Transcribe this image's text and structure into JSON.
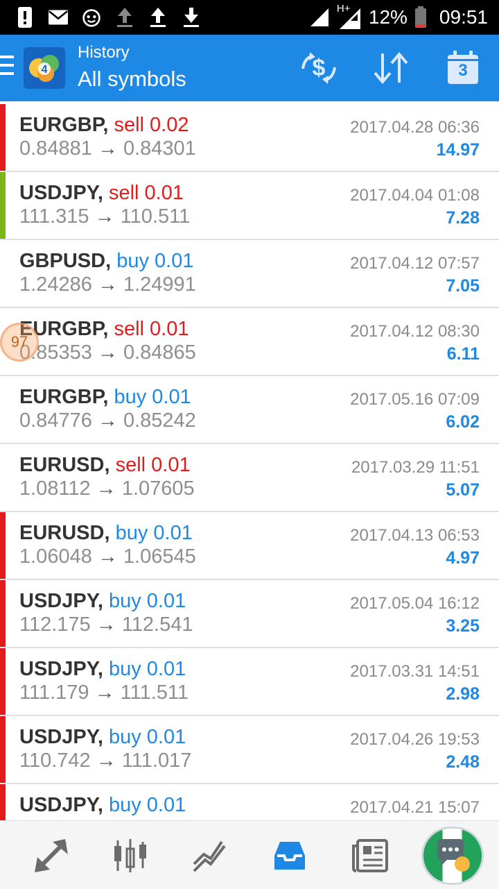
{
  "statusbar": {
    "network": "H+",
    "battery": "12%",
    "time": "09:51"
  },
  "appbar": {
    "subtitle": "History",
    "title": "All symbols",
    "calendar_day": "3"
  },
  "colors": {
    "accent": "#1e88e5",
    "sell": "#e21c1c",
    "buy": "#1e88e5",
    "bar_red": "#e21c1c",
    "bar_green": "#7cb518"
  },
  "trades": [
    {
      "symbol": "EURGBP,",
      "side": "sell",
      "volume": "sell 0.02",
      "open": "0.84881",
      "close": "0.84301",
      "date": "2017.04.28 06:36",
      "profit": "14.97",
      "bar": "red"
    },
    {
      "symbol": "USDJPY,",
      "side": "sell",
      "volume": "sell 0.01",
      "open": "111.315",
      "close": "110.511",
      "date": "2017.04.04 01:08",
      "profit": "7.28",
      "bar": "green"
    },
    {
      "symbol": "GBPUSD,",
      "side": "buy",
      "volume": "buy 0.01",
      "open": "1.24286",
      "close": "1.24991",
      "date": "2017.04.12 07:57",
      "profit": "7.05",
      "bar": "none"
    },
    {
      "symbol": "EURGBP,",
      "side": "sell",
      "volume": "sell 0.01",
      "open": "0.85353",
      "close": "0.84865",
      "date": "2017.04.12 08:30",
      "profit": "6.11",
      "bar": "none"
    },
    {
      "symbol": "EURGBP,",
      "side": "buy",
      "volume": "buy 0.01",
      "open": "0.84776",
      "close": "0.85242",
      "date": "2017.05.16 07:09",
      "profit": "6.02",
      "bar": "none"
    },
    {
      "symbol": "EURUSD,",
      "side": "sell",
      "volume": "sell 0.01",
      "open": "1.08112",
      "close": "1.07605",
      "date": "2017.03.29 11:51",
      "profit": "5.07",
      "bar": "none"
    },
    {
      "symbol": "EURUSD,",
      "side": "buy",
      "volume": "buy 0.01",
      "open": "1.06048",
      "close": "1.06545",
      "date": "2017.04.13 06:53",
      "profit": "4.97",
      "bar": "red"
    },
    {
      "symbol": "USDJPY,",
      "side": "buy",
      "volume": "buy 0.01",
      "open": "112.175",
      "close": "112.541",
      "date": "2017.05.04 16:12",
      "profit": "3.25",
      "bar": "red"
    },
    {
      "symbol": "USDJPY,",
      "side": "buy",
      "volume": "buy 0.01",
      "open": "111.179",
      "close": "111.511",
      "date": "2017.03.31 14:51",
      "profit": "2.98",
      "bar": "red"
    },
    {
      "symbol": "USDJPY,",
      "side": "buy",
      "volume": "buy 0.01",
      "open": "110.742",
      "close": "111.017",
      "date": "2017.04.26 19:53",
      "profit": "2.48",
      "bar": "red"
    },
    {
      "symbol": "USDJPY,",
      "side": "buy",
      "volume": "buy 0.01",
      "open": "",
      "close": "",
      "date": "2017.04.21 15:07",
      "profit": "",
      "bar": "red"
    }
  ],
  "arrow_glyph": "→",
  "overlay_badge": "97",
  "bottomnav": {
    "items": [
      "trade-icon",
      "chart-icon",
      "trend-icon",
      "history-icon",
      "news-icon"
    ],
    "active": "history-icon"
  }
}
